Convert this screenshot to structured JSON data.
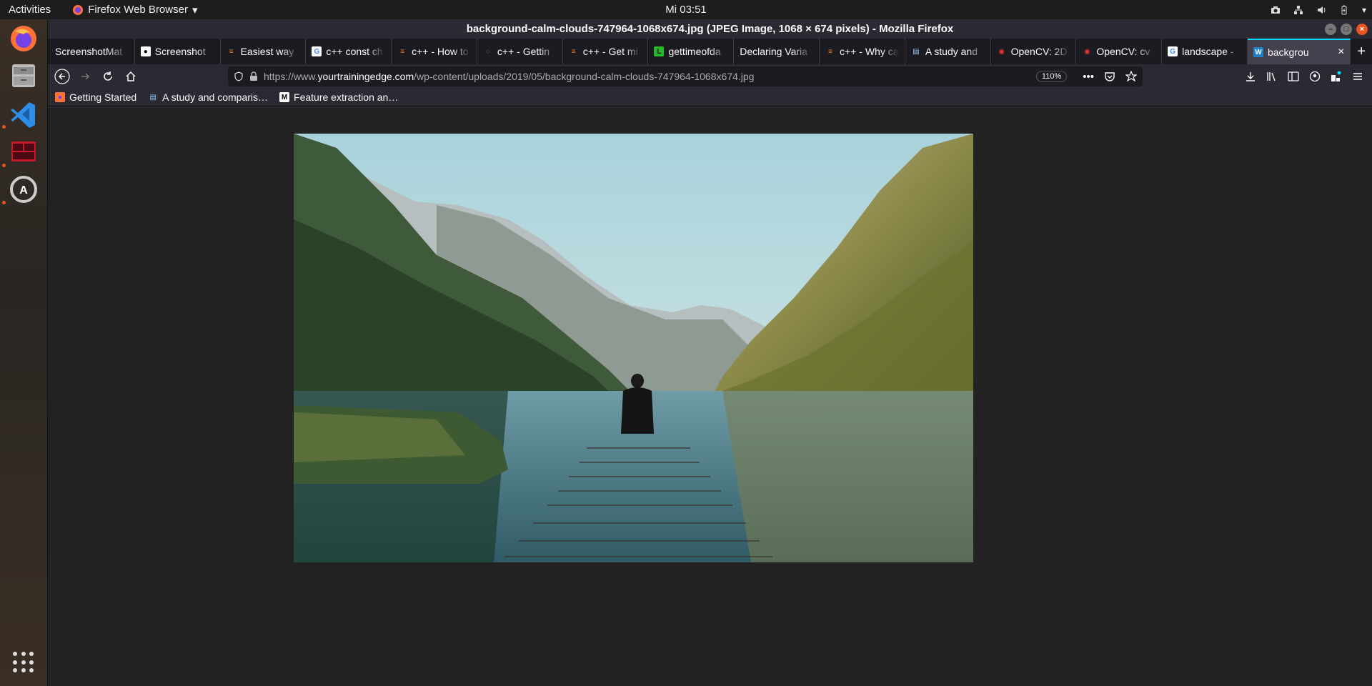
{
  "topbar": {
    "activities": "Activities",
    "app_name": "Firefox Web Browser",
    "clock": "Mi 03:51"
  },
  "window": {
    "title": "background-calm-clouds-747964-1068x674.jpg (JPEG Image, 1068 × 674 pixels) - Mozilla Firefox"
  },
  "tabs": [
    {
      "label": "ScreenshotMat",
      "icon": "none"
    },
    {
      "label": "Screenshot",
      "icon": "github-icon"
    },
    {
      "label": "Easiest way",
      "icon": "stackoverflow-icon"
    },
    {
      "label": "c++ const ch",
      "icon": "google-icon"
    },
    {
      "label": "c++ - How to",
      "icon": "stackoverflow-icon"
    },
    {
      "label": "c++ - Gettin",
      "icon": "globe-icon"
    },
    {
      "label": "c++ - Get mi",
      "icon": "stackoverflow-icon"
    },
    {
      "label": "gettimeofda",
      "icon": "linux-icon"
    },
    {
      "label": "Declaring Varia",
      "icon": "none"
    },
    {
      "label": "c++ - Why ca",
      "icon": "stackoverflow-icon"
    },
    {
      "label": "A study and",
      "icon": "document-icon"
    },
    {
      "label": "OpenCV: 2D",
      "icon": "opencv-icon"
    },
    {
      "label": "OpenCV: cv",
      "icon": "opencv-icon"
    },
    {
      "label": "landscape -",
      "icon": "google-icon"
    },
    {
      "label": "backgrou",
      "icon": "wordpress-icon",
      "active": true
    }
  ],
  "urlbar": {
    "prefix": "https://www.",
    "domain": "yourtrainingedge.com",
    "path": "/wp-content/uploads/2019/05/background-calm-clouds-747964-1068x674.jpg",
    "zoom": "110%"
  },
  "bookmarks": [
    {
      "label": "Getting Started",
      "icon": "firefox-icon"
    },
    {
      "label": "A study and comparis…",
      "icon": "document-icon"
    },
    {
      "label": "Feature extraction an…",
      "icon": "medium-icon"
    }
  ],
  "colors": {
    "accent": "#e95420",
    "tab_active_indicator": "#00ddff",
    "content_bg": "#222222"
  }
}
